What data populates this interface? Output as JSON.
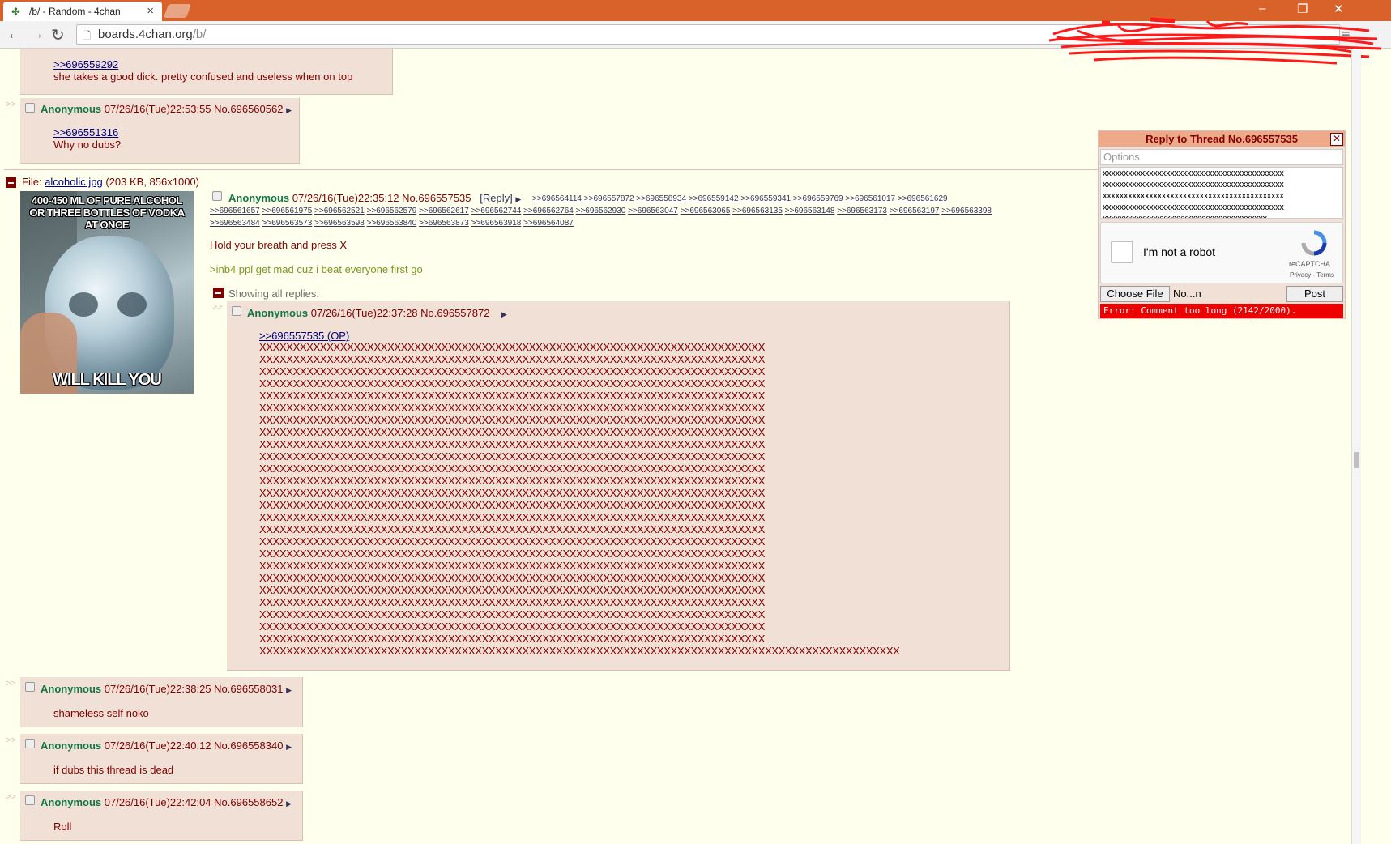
{
  "browser": {
    "tab_title": "/b/ - Random - 4chan",
    "url_host": "boards.4chan.org",
    "url_path": "/b/"
  },
  "posts_top": [
    {
      "quote": ">>696559292",
      "text": "she takes a good dick. pretty confused and useless when on top"
    },
    {
      "name": "Anonymous",
      "meta": "07/26/16(Tue)22:53:55 No.696560562",
      "quote": ">>696551316",
      "text": "Why no dubs?"
    }
  ],
  "op": {
    "file_prefix": "File:",
    "file_name": "alcoholic.jpg",
    "file_info": "(203 KB, 856x1000)",
    "image_top_text": "400-450 ML OF PURE ALCOHOL OR THREE BOTTLES OF VODKA AT ONCE",
    "image_bottom_text": "WILL KILL YOU",
    "name": "Anonymous",
    "meta": "07/26/16(Tue)22:35:12 No.696557535",
    "reply_label": "[Reply]",
    "backlinks": [
      ">>696564114",
      ">>696557872",
      ">>696558934",
      ">>696559142",
      ">>696559341",
      ">>696559769",
      ">>696561017",
      ">>696561629",
      ">>696561657",
      ">>696561975",
      ">>696562521",
      ">>696562579",
      ">>696562617",
      ">>696562744",
      ">>696562764",
      ">>696562930",
      ">>696563047",
      ">>696563065",
      ">>696563135",
      ">>696563148",
      ">>696563173",
      ">>696563197",
      ">>696563398",
      ">>696563484",
      ">>696563573",
      ">>696563598",
      ">>696563840",
      ">>696563873",
      ">>696563918",
      ">>696564087"
    ],
    "text": "Hold your breath and press X",
    "greentext": ">inb4 ppl get mad cuz i beat everyone first go",
    "showing_replies": "Showing all replies."
  },
  "inline_reply": {
    "name": "Anonymous",
    "meta": "07/26/16(Tue)22:37:28 No.696557872",
    "quote": ">>696557535 (OP)",
    "x_line": "XXXXXXXXXXXXXXXXXXXXXXXXXXXXXXXXXXXXXXXXXXXXXXXXXXXXXXXXXXXXXXXXXXXXXXXXXXX",
    "x_last": "XXXXXXXXXXXXXXXXXXXXXXXXXXXXXXXXXXXXXXXXXXXXXXXXXXXXXXXXXXXXXXXXXXXXXXXXXXXXXXXXXXXXXXXXXXXXXXX"
  },
  "posts_bottom": [
    {
      "name": "Anonymous",
      "meta": "07/26/16(Tue)22:38:25 No.696558031",
      "text": "shameless self noko"
    },
    {
      "name": "Anonymous",
      "meta": "07/26/16(Tue)22:40:12 No.696558340",
      "text": "if dubs this thread is dead"
    },
    {
      "name": "Anonymous",
      "meta": "07/26/16(Tue)22:42:04 No.696558652",
      "text": "Roll"
    }
  ],
  "quick_reply": {
    "title": "Reply to Thread No.696557535",
    "options_placeholder": "Options",
    "comment_line": "xxxxxxxxxxxxxxxxxxxxxxxxxxxxxxxxxxxxxxxxxxx",
    "comment_last": "xxxxxxxxxxxxxxxxxxxxxxxxxxxxxxxxxxxxxxx",
    "captcha_label": "I'm not a robot",
    "captcha_brand": "reCAPTCHA",
    "captcha_links": "Privacy - Terms",
    "choose_file": "Choose File",
    "file_name": "No...n",
    "post_button": "Post",
    "error": "Error: Comment too long (2142/2000)."
  },
  "icons": [
    "four-leaf-favicon",
    "back-arrow-icon",
    "forward-arrow-icon",
    "reload-icon",
    "page-icon",
    "menu-icon",
    "minimize-icon",
    "restore-icon",
    "close-icon",
    "collapse-icon"
  ],
  "colors": {
    "tab_bar": "#D9622B",
    "background": "#FFFFEE",
    "reply_bg": "#F0E0D6",
    "name": "#117743",
    "greentext": "#789922",
    "error": "#E00000"
  }
}
